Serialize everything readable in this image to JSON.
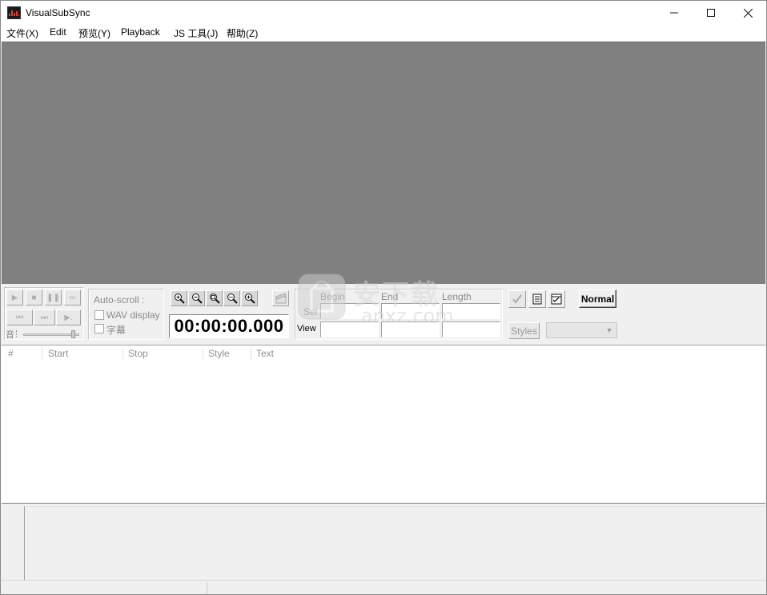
{
  "window": {
    "title": "VisualSubSync",
    "controls": {
      "minimize": "—",
      "maximize": "☐",
      "close": "✕"
    }
  },
  "menu": [
    "文件(X)",
    "Edit",
    "预览(Y)",
    "Playback",
    "JS 工具(J)",
    "帮助(Z)"
  ],
  "toolbar": {
    "autoscroll_label": "Auto-scroll :",
    "wav_display_label": "WAV display",
    "subtitle_label": "字幕",
    "volume_label": "音",
    "time_display": "00:00:00.000",
    "sel_label": "Sel",
    "view_label": "View",
    "begin_label": "Begin",
    "end_label": "End",
    "length_label": "Length",
    "mode_button": "Normal",
    "styles_button": "Styles"
  },
  "list": {
    "columns": [
      "#",
      "Start",
      "Stop",
      "Style",
      "Text"
    ]
  },
  "watermark": {
    "cn": "安下载",
    "url": "anxz.com"
  },
  "colors": {
    "video_bg": "#808080",
    "window_bg": "#f0f0f0",
    "icon_red": "#e53935"
  }
}
